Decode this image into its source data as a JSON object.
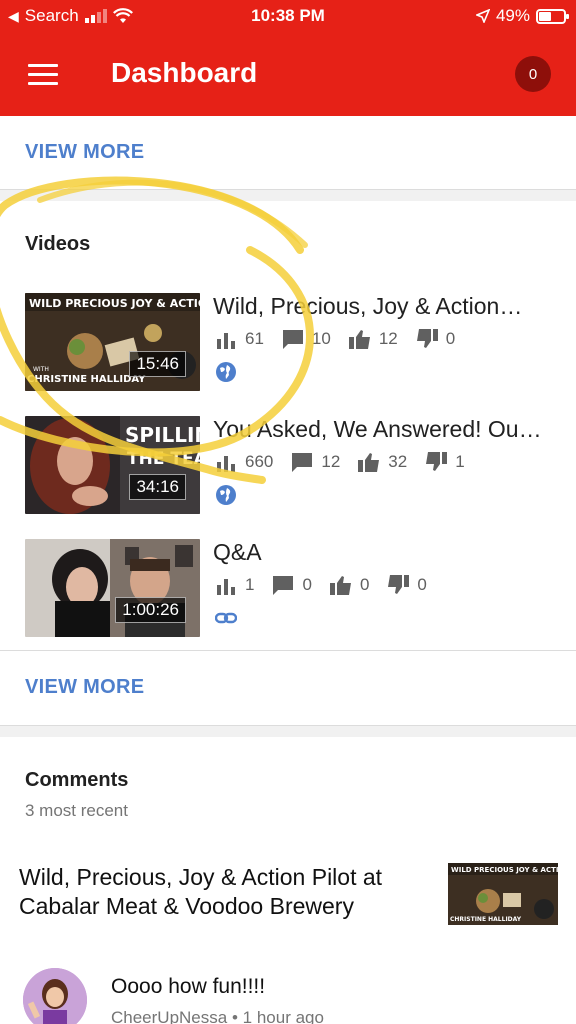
{
  "status_bar": {
    "back_label": "Search",
    "time": "10:38 PM",
    "battery_percent": "49%",
    "battery_level": 0.49
  },
  "app_bar": {
    "title": "Dashboard",
    "notification_count": "0",
    "colors": {
      "primary": "#e62117",
      "badge": "#8e0f0a"
    }
  },
  "top_view_more": "VIEW MORE",
  "videos": {
    "heading": "Videos",
    "items": [
      {
        "title": "Wild, Precious, Joy & Action…",
        "duration": "15:46",
        "views": "61",
        "comments": "10",
        "likes": "12",
        "dislikes": "0",
        "visibility": "globe-icon"
      },
      {
        "title": "You Asked, We Answered! Ou…",
        "duration": "34:16",
        "views": "660",
        "comments": "12",
        "likes": "32",
        "dislikes": "1",
        "visibility": "globe-icon"
      },
      {
        "title": "Q&A",
        "duration": "1:00:26",
        "views": "1",
        "comments": "0",
        "likes": "0",
        "dislikes": "0",
        "visibility": "link-icon"
      }
    ],
    "view_more": "VIEW MORE"
  },
  "comments": {
    "heading": "Comments",
    "subtitle": "3 most recent",
    "video_title": "Wild, Precious, Joy & Action Pilot at Cabalar Meat & Voodoo Brewery",
    "entries": [
      {
        "text": "Oooo how fun!!!!",
        "author": "CheerUpNessa",
        "age": "1 hour ago"
      }
    ]
  },
  "thumb_text": {
    "banner": "WILD PRECIOUS JOY & ACTION",
    "with": "WITH",
    "name": "CHRISTINE HALLIDAY",
    "spill1": "SPILLIN",
    "spill2": "THE TEA!"
  },
  "accent_color": "#4e7fcc"
}
